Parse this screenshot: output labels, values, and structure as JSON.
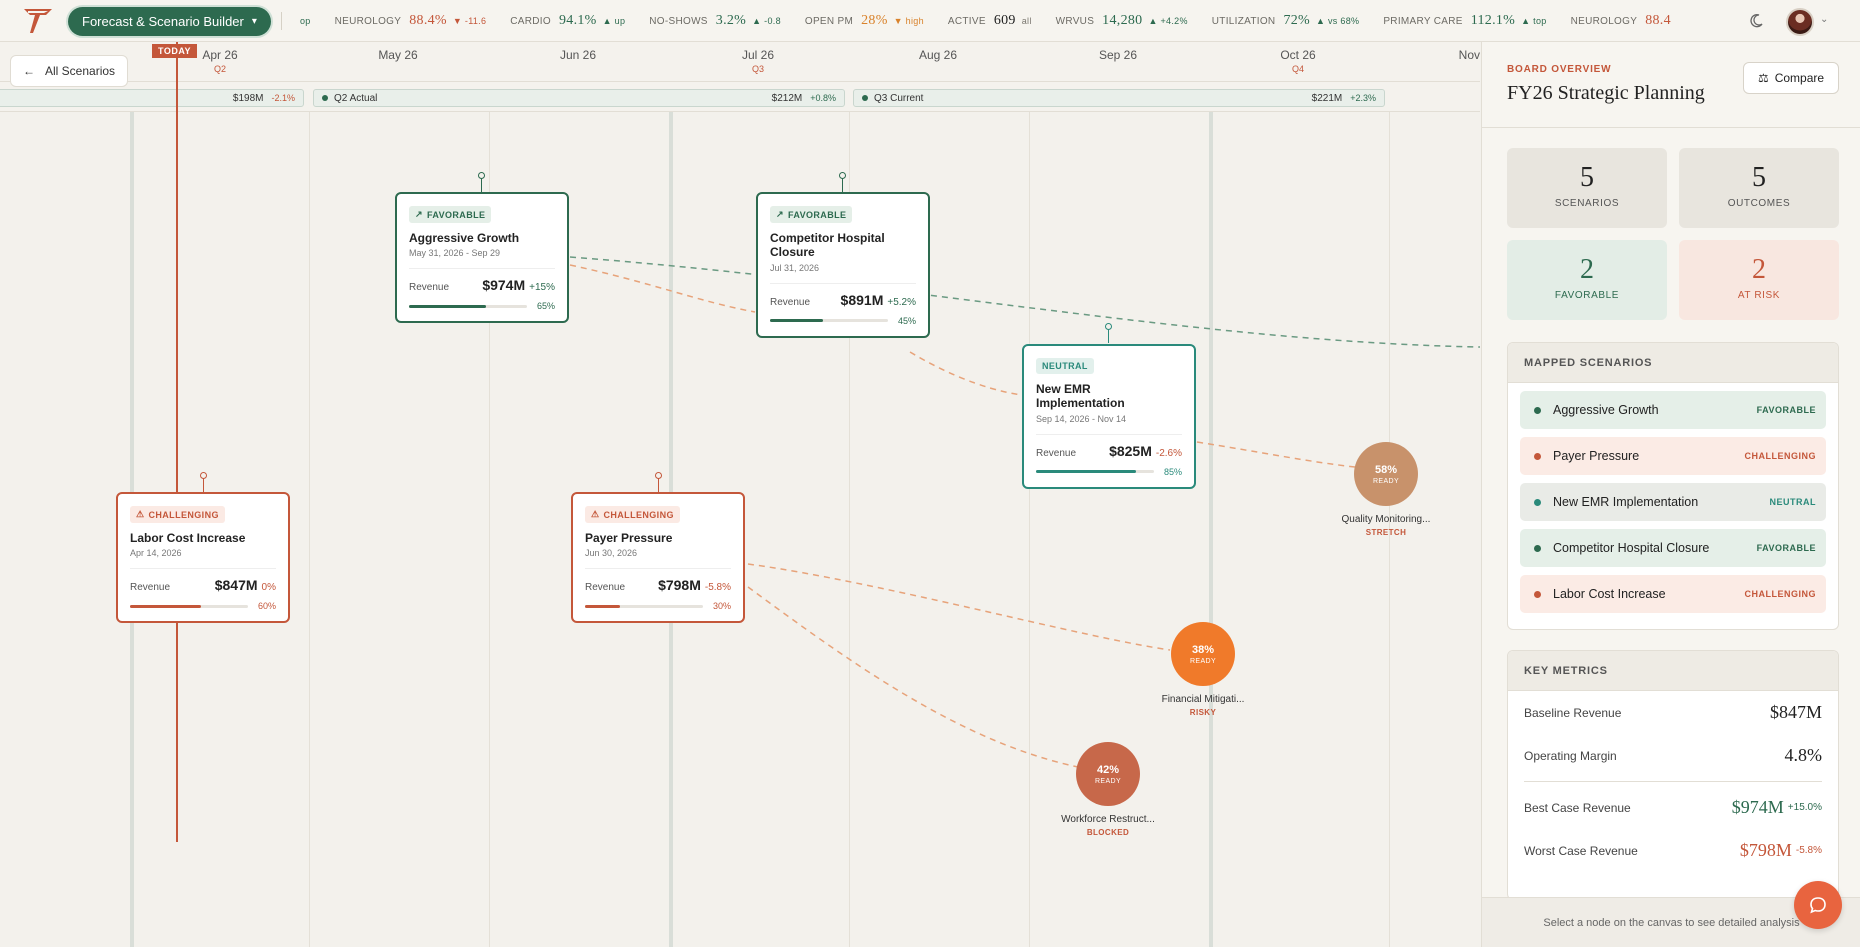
{
  "app": {
    "title": "Forecast & Scenario Builder"
  },
  "ticker": [
    {
      "label": "",
      "value": "",
      "change": "op",
      "tone": "up"
    },
    {
      "label": "NEUROLOGY",
      "value": "88.4%",
      "change": "▼ -11.6",
      "tone": "down"
    },
    {
      "label": "CARDIO",
      "value": "94.1%",
      "change": "▲ up",
      "tone": "up"
    },
    {
      "label": "NO-SHOWS",
      "value": "3.2%",
      "change": "▲ -0.8",
      "tone": "up"
    },
    {
      "label": "OPEN PM",
      "value": "28%",
      "change": "▼ high",
      "tone": "warn"
    },
    {
      "label": "ACTIVE",
      "value": "609",
      "change": "all",
      "tone": "muted"
    },
    {
      "label": "WRVUS",
      "value": "14,280",
      "change": "▲ +4.2%",
      "tone": "up"
    },
    {
      "label": "UTILIZATION",
      "value": "72%",
      "change": "▲ vs 68%",
      "tone": "up"
    },
    {
      "label": "PRIMARY CARE",
      "value": "112.1%",
      "change": "▲ top",
      "tone": "up"
    },
    {
      "label": "NEUROLOGY",
      "value": "88.4",
      "change": "",
      "tone": "down"
    }
  ],
  "nav": {
    "back_label": "All Scenarios",
    "today_label": "TODAY"
  },
  "months": [
    {
      "label": "Apr 26",
      "quarter": "Q2"
    },
    {
      "label": "May 26",
      "quarter": ""
    },
    {
      "label": "Jun 26",
      "quarter": ""
    },
    {
      "label": "Jul 26",
      "quarter": "Q3"
    },
    {
      "label": "Aug 26",
      "quarter": ""
    },
    {
      "label": "Sep 26",
      "quarter": ""
    },
    {
      "label": "Oct 26",
      "quarter": "Q4"
    },
    {
      "label": "Nov",
      "quarter": ""
    }
  ],
  "quarter_bars": [
    {
      "label": "",
      "amount": "$198M",
      "change": "-2.1%",
      "tone": "down"
    },
    {
      "label": "Q2 Actual",
      "amount": "$212M",
      "change": "+0.8%",
      "tone": "up"
    },
    {
      "label": "Q3 Current",
      "amount": "$221M",
      "change": "+2.3%",
      "tone": "up"
    }
  ],
  "scenarios": [
    {
      "badge": "FAVORABLE",
      "title": "Aggressive Growth",
      "date": "May 31, 2026 - Sep 29",
      "rev_label": "Revenue",
      "revenue": "$974M",
      "change": "+15%",
      "progress": 0.65,
      "progress_label": "65%"
    },
    {
      "badge": "FAVORABLE",
      "title": "Competitor Hospital Closure",
      "date": "Jul 31, 2026",
      "rev_label": "Revenue",
      "revenue": "$891M",
      "change": "+5.2%",
      "progress": 0.45,
      "progress_label": "45%"
    },
    {
      "badge": "NEUTRAL",
      "title": "New EMR Implementation",
      "date": "Sep 14, 2026 - Nov 14",
      "rev_label": "Revenue",
      "revenue": "$825M",
      "change": "-2.6%",
      "progress": 0.85,
      "progress_label": "85%"
    },
    {
      "badge": "CHALLENGING",
      "title": "Labor Cost Increase",
      "date": "Apr 14, 2026",
      "rev_label": "Revenue",
      "revenue": "$847M",
      "change": "0%",
      "progress": 0.6,
      "progress_label": "60%"
    },
    {
      "badge": "CHALLENGING",
      "title": "Payer Pressure",
      "date": "Jun 30, 2026",
      "rev_label": "Revenue",
      "revenue": "$798M",
      "change": "-5.8%",
      "progress": 0.3,
      "progress_label": "30%"
    }
  ],
  "outcomes": [
    {
      "pct": "58%",
      "state": "READY",
      "name": "Quality Monitoring...",
      "status": "STRETCH",
      "color": "#c8926b",
      "status_color": "#c4573a"
    },
    {
      "pct": "38%",
      "state": "READY",
      "name": "Financial Mitigati...",
      "status": "RISKY",
      "color": "#f07a2a",
      "status_color": "#c4573a"
    },
    {
      "pct": "42%",
      "state": "READY",
      "name": "Workforce Restruct...",
      "status": "BLOCKED",
      "color": "#c7684a",
      "status_color": "#c4573a"
    }
  ],
  "panel": {
    "eyebrow": "BOARD OVERVIEW",
    "title": "FY26 Strategic Planning",
    "compare_label": "Compare",
    "stats": [
      {
        "num": "5",
        "label": "SCENARIOS",
        "kind": ""
      },
      {
        "num": "5",
        "label": "OUTCOMES",
        "kind": ""
      },
      {
        "num": "2",
        "label": "FAVORABLE",
        "kind": "fav"
      },
      {
        "num": "2",
        "label": "AT RISK",
        "kind": "risk"
      }
    ],
    "mapped_header": "MAPPED SCENARIOS",
    "mapped": [
      {
        "name": "Aggressive Growth",
        "status": "FAVORABLE",
        "kind": "fav"
      },
      {
        "name": "Payer Pressure",
        "status": "CHALLENGING",
        "kind": "chal"
      },
      {
        "name": "New EMR Implementation",
        "status": "NEUTRAL",
        "kind": "neut"
      },
      {
        "name": "Competitor Hospital Closure",
        "status": "FAVORABLE",
        "kind": "fav"
      },
      {
        "name": "Labor Cost Increase",
        "status": "CHALLENGING",
        "kind": "chal"
      }
    ],
    "metrics_header": "KEY METRICS",
    "metrics": [
      {
        "label": "Baseline Revenue",
        "value": "$847M",
        "change": "",
        "kind": ""
      },
      {
        "label": "Operating Margin",
        "value": "4.8%",
        "change": "",
        "kind": ""
      },
      {
        "label": "Best Case Revenue",
        "value": "$974M",
        "change": "+15.0%",
        "kind": "good"
      },
      {
        "label": "Worst Case Revenue",
        "value": "$798M",
        "change": "-5.8%",
        "kind": "bad"
      }
    ],
    "footer": "Select a node on the canvas to see detailed analysis"
  },
  "colors": {
    "brand_green": "#2d6a4f",
    "accent_red": "#c4573a",
    "neutral_teal": "#2a8a7b",
    "chat_orange": "#e8643f"
  }
}
